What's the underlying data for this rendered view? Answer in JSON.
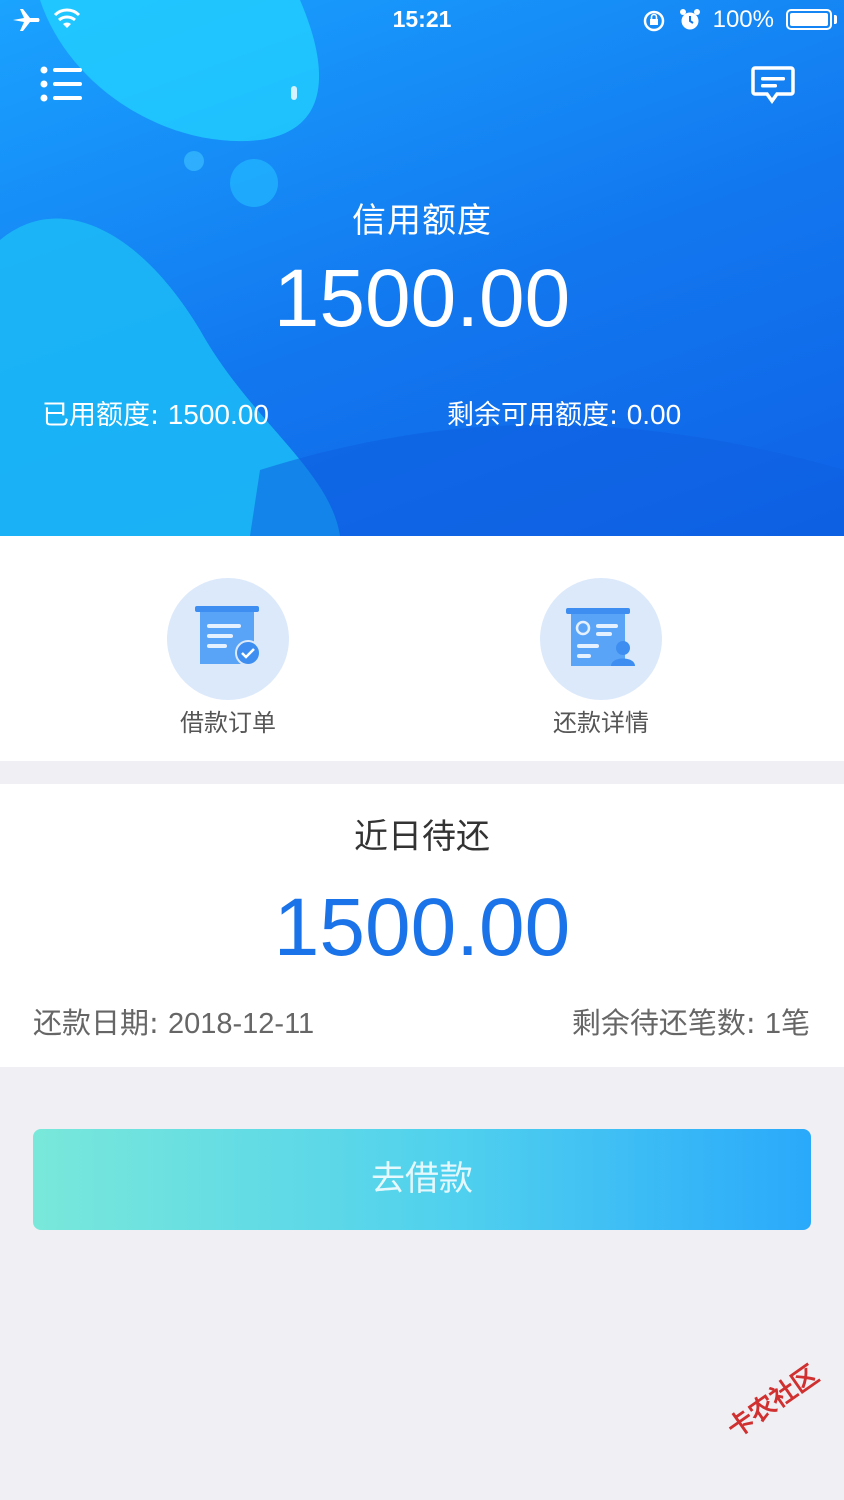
{
  "status_bar": {
    "time": "15:21",
    "battery_text": "100%",
    "icons": [
      "airplane-icon",
      "wifi-icon",
      "orientation-lock-icon",
      "alarm-icon",
      "battery-icon"
    ]
  },
  "header": {
    "menu_icon": "menu-icon",
    "message_icon": "message-icon"
  },
  "credit": {
    "title": "信用额度",
    "amount": "1500.00",
    "used_label": "已用额度: ",
    "used_value": "1500.00",
    "remaining_label": "剩余可用额度: ",
    "remaining_value": "0.00"
  },
  "shortcuts": [
    {
      "label": "借款订单",
      "icon": "loan-order-icon"
    },
    {
      "label": "还款详情",
      "icon": "repayment-details-icon"
    }
  ],
  "due": {
    "title": "近日待还",
    "amount": "1500.00",
    "date_label": "还款日期: ",
    "date_value": "2018-12-11",
    "count_label": "剩余待还笔数: ",
    "count_value": "1笔"
  },
  "cta": {
    "label": "去借款"
  },
  "watermark": "卡农社区",
  "colors": {
    "hero_blue": "#1277ef",
    "amount_blue": "#1a73e8",
    "page_bg": "#efeff4",
    "cta_start": "#79e8da",
    "cta_end": "#2aa9fb"
  }
}
